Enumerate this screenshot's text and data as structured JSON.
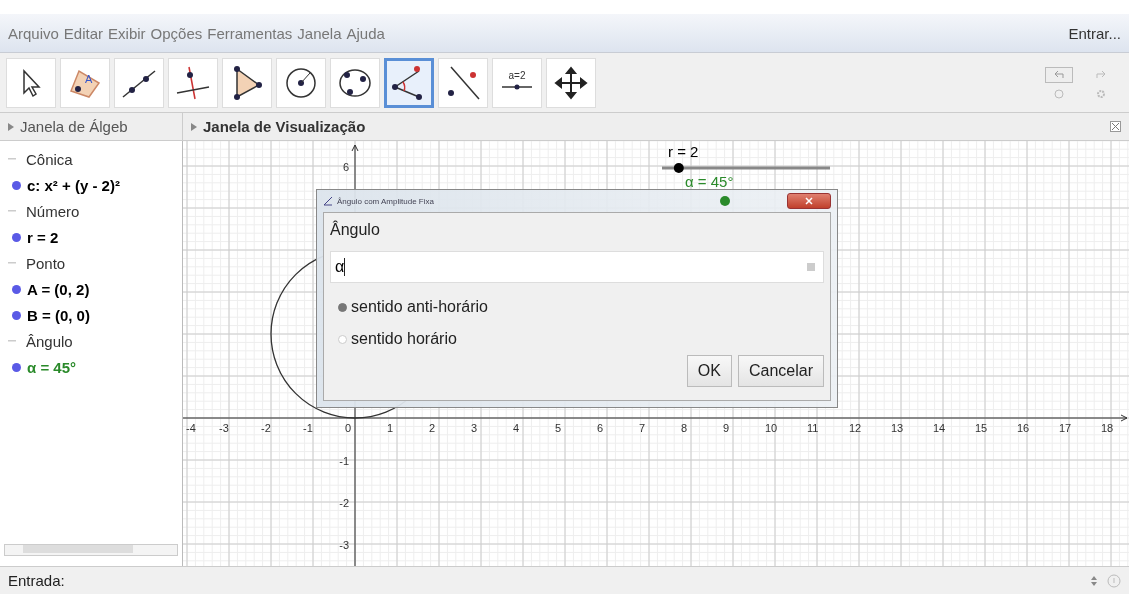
{
  "menu": {
    "items": [
      "Arquivo",
      "Editar",
      "Exibir",
      "Opções",
      "Ferramentas",
      "Janela",
      "Ajuda"
    ],
    "sign_in": "Entrar..."
  },
  "toolbar": {
    "tools": [
      {
        "kind": "move",
        "selected": false
      },
      {
        "kind": "polygon",
        "caption": "A",
        "selected": false
      },
      {
        "kind": "line",
        "selected": false
      },
      {
        "kind": "perpendicular",
        "selected": false
      },
      {
        "kind": "triangle",
        "selected": false
      },
      {
        "kind": "circle",
        "selected": false
      },
      {
        "kind": "conic",
        "selected": false
      },
      {
        "kind": "angle",
        "selected": true
      },
      {
        "kind": "reflect",
        "selected": false
      },
      {
        "kind": "slider",
        "caption": "a=2",
        "selected": false
      },
      {
        "kind": "pan",
        "selected": false
      }
    ]
  },
  "views": {
    "algebra_title": "Janela de Álgeb",
    "graphics_title": "Janela de Visualização"
  },
  "algebra": [
    {
      "category": "Cônica",
      "children": [
        {
          "text": "c: x² + (y - 2)²",
          "color": "#000000"
        }
      ]
    },
    {
      "category": "Número",
      "children": [
        {
          "text": "r = 2",
          "color": "#000000"
        }
      ]
    },
    {
      "category": "Ponto",
      "children": [
        {
          "text": "A = (0, 2)",
          "color": "#000000"
        },
        {
          "text": "B = (0, 0)",
          "color": "#000000"
        }
      ]
    },
    {
      "category": "Ângulo",
      "children": [
        {
          "text": "α = 45°",
          "color": "#2a8a2a"
        }
      ]
    }
  ],
  "graphics": {
    "x_tick_labels": [
      "-4",
      "-3",
      "-2",
      "-1",
      "0",
      "1",
      "2",
      "3",
      "4",
      "5",
      "6",
      "7",
      "8",
      "9",
      "10",
      "11",
      "12",
      "13",
      "14",
      "15",
      "16",
      "17",
      "18"
    ],
    "y_tick_labels": [
      "6",
      "-1",
      "-2",
      "-3"
    ],
    "sliders": [
      {
        "label": "r = 2",
        "level": 0.1,
        "color": "#000000"
      },
      {
        "label": "α = 45°",
        "color": "#2a8a2a"
      }
    ]
  },
  "dialog": {
    "title": "Ângulo com Amplitude Fixa",
    "label": "Ângulo",
    "value": "α",
    "options": [
      {
        "label": "sentido anti-horário",
        "selected": true
      },
      {
        "label": "sentido horário",
        "selected": false
      }
    ],
    "buttons": [
      "OK",
      "Cancelar"
    ]
  },
  "input_bar": {
    "label": "Entrada:"
  }
}
